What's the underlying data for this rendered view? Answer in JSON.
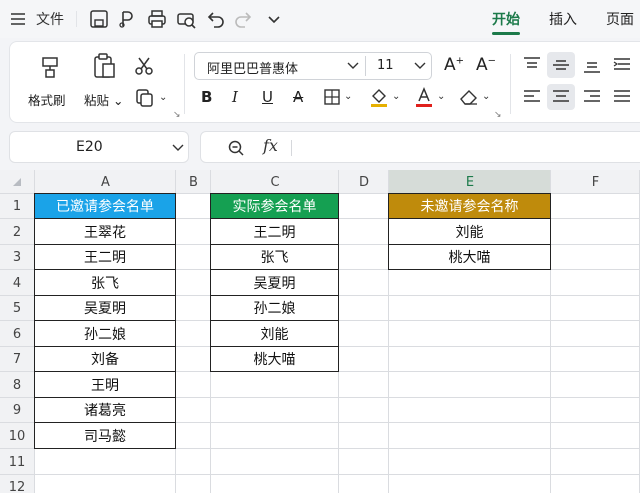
{
  "menubar": {
    "file_label": "文件",
    "tabs": [
      "开始",
      "插入",
      "页面"
    ]
  },
  "ribbon": {
    "format_painter_label": "格式刷",
    "paste_label": "粘贴",
    "font_name": "阿里巴巴普惠体",
    "font_size": "11"
  },
  "formula_bar": {
    "name_box": "E20",
    "fx_label": "fx",
    "content": ""
  },
  "sheet": {
    "columns": [
      "A",
      "B",
      "C",
      "D",
      "E",
      "F"
    ],
    "rows": [
      "1",
      "2",
      "3",
      "4",
      "5",
      "6",
      "7",
      "8",
      "9",
      "10",
      "11",
      "12"
    ],
    "table_a": {
      "header": "已邀请参会名单",
      "header_color": "#1aa3e8",
      "names": [
        "王翠花",
        "王二明",
        "张飞",
        "吴夏明",
        "孙二娘",
        "刘备",
        "王明",
        "诸葛亮",
        "司马懿"
      ]
    },
    "table_c": {
      "header": "实际参会名单",
      "header_color": "#15a052",
      "names": [
        "王二明",
        "张飞",
        "吴夏明",
        "孙二娘",
        "刘能",
        "桃大喵"
      ]
    },
    "table_e": {
      "header": "未邀请参会名称",
      "header_color": "#bf8b0c",
      "names": [
        "刘能",
        "桃大喵"
      ]
    }
  }
}
